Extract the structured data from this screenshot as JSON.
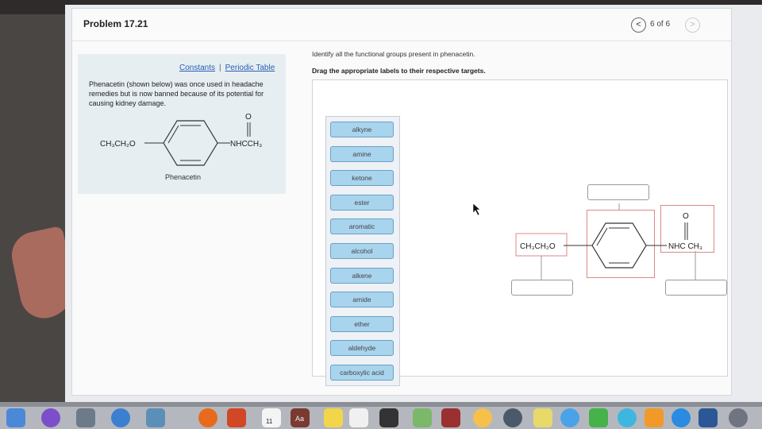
{
  "problem_title": "Problem 17.21",
  "nav": {
    "prev": "<",
    "count": "6 of 6",
    "next": ">"
  },
  "links": {
    "constants": "Constants",
    "periodic_table": "Periodic Table"
  },
  "description": "Phenacetin (shown below) was once used in headache remedies but is now banned because of its potential for causing kidney damage.",
  "molecule": {
    "left_group": "CH₃CH₂O",
    "right_group": "NHCCH₃",
    "oxygen": "O",
    "caption": "Phenacetin"
  },
  "instructions": {
    "line1": "Identify all the functional groups present in phenacetin.",
    "line2": "Drag the appropriate labels to their respective targets."
  },
  "labels": [
    "alkyne",
    "amine",
    "ketone",
    "ester",
    "aromatic",
    "alcohol",
    "alkene",
    "amide",
    "ether",
    "aldehyde",
    "carboxylic acid"
  ],
  "target_molecule": {
    "left_group": "CH₃CH₂O",
    "right_group": "NHC CH₃",
    "oxygen": "O"
  },
  "dock": {
    "calendar_day": "11",
    "dictionary": "Aa"
  },
  "colors": {
    "label_fill": "#a9d4ee",
    "label_border": "#6aa0c4",
    "group_box": "#d88",
    "link": "#2a5db0"
  }
}
